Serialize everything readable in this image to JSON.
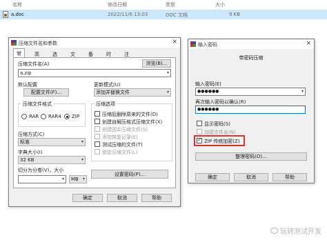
{
  "explorer": {
    "columns": [
      "名称",
      "修改日期",
      "类型",
      "大小"
    ],
    "file": {
      "name": "a.doc",
      "modified": "2022/11/6 13:03",
      "type": "DOC 文档",
      "size": "9 KB"
    }
  },
  "zip_dialog": {
    "title": "压缩文件名和参数",
    "close": "×",
    "tabs": [
      "常规",
      "高级",
      "选项",
      "文件",
      "备份",
      "时间",
      "注释"
    ],
    "archive_name_label": "压缩文件名(A)",
    "archive_name_value": "a.zip",
    "browse_button": "浏览(B)...",
    "default_config_label": "默认配置",
    "profiles_button": "配置文件(F)...",
    "update_mode_label": "更新模式(U)",
    "update_mode_value": "添加并替换文件",
    "format_group": "压缩文件格式",
    "formats": [
      "RAR",
      "RAR4",
      "ZIP"
    ],
    "method_label": "压缩方式(C)",
    "method_value": "标准",
    "dict_label": "字典大小(I)",
    "dict_value": "32 KB",
    "split_label": "切分为分卷(V)，大小",
    "split_unit": "MB",
    "options_group": "压缩选项",
    "options": [
      {
        "label": "压缩后删除原来的文件(D)",
        "disabled": false
      },
      {
        "label": "创建自解压格式压缩文件(X)",
        "disabled": false
      },
      {
        "label": "创建固实压缩文件(S)",
        "disabled": true
      },
      {
        "label": "添加恢复记录(E)",
        "disabled": true
      },
      {
        "label": "测试压缩的文件(T)",
        "disabled": false
      },
      {
        "label": "锁定压缩文件(L)",
        "disabled": true
      }
    ],
    "set_password_button": "设置密码(P)...",
    "ok": "确定",
    "cancel": "取消",
    "help": "帮助"
  },
  "password_dialog": {
    "title": "输入密码",
    "close": "×",
    "heading": "带密码压缩",
    "enter_label": "输入密码(E)",
    "enter_value": "●●●●●●",
    "reenter_label": "再次输入密码以确认(R)",
    "reenter_value": "●●●●●●",
    "show_password": "显示密码(S)",
    "encrypt_names": "加密文件名(N)",
    "zip_legacy": "ZIP 传统加密(Z)",
    "organize_button": "整理密码(O)...",
    "ok": "确定",
    "cancel": "取消",
    "help": "帮助"
  },
  "watermark": "玩转测试开发",
  "colors": {
    "highlight": "#e0302a",
    "selection": "#cce8ff",
    "accent": "#0078d7"
  }
}
